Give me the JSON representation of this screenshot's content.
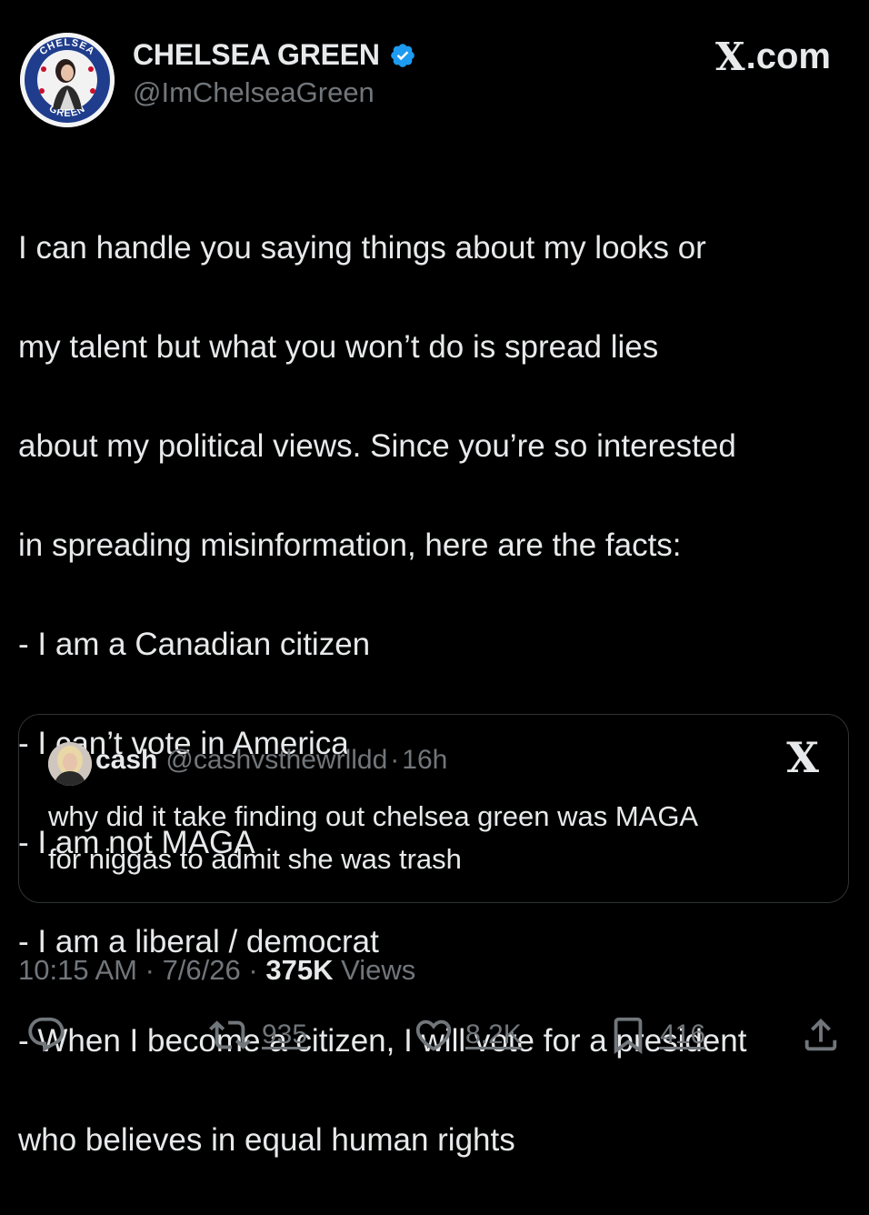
{
  "author": {
    "display_name": "CHELSEA GREEN",
    "handle": "@ImChelseaGreen",
    "avatar_badge_top": "CHELSEA",
    "avatar_badge_bottom": "GREEN",
    "verified": true
  },
  "brand": {
    "logo": "X",
    "text": ".com"
  },
  "tweet": {
    "lines": [
      "I can handle you saying things about my looks or",
      "my talent but what you won’t do is spread lies",
      "about my political views. Since you’re so interested",
      "in spreading misinformation, here are the facts:",
      "- I am a Canadian citizen",
      "- I can’t vote in America",
      "- I am not MAGA",
      "- I am a liberal / democrat",
      "- When I become a citizen, I will vote for a president",
      "who believes in equal human rights"
    ]
  },
  "quote": {
    "name": "cash",
    "handle": "@cashvsthewrlldd",
    "separator": "·",
    "time": "16h",
    "logo": "X",
    "text_lines": [
      "why did it take finding out chelsea green was MAGA",
      "for niggas to admit she was trash"
    ]
  },
  "meta": {
    "time": "10:15 AM",
    "date": "7/6/26",
    "separator": "·",
    "views_count": "375K",
    "views_label": "Views"
  },
  "actions": {
    "reply_icon": "reply-icon",
    "retweet_icon": "retweet-icon",
    "retweets": "935",
    "like_icon": "heart-icon",
    "likes": "8.2K",
    "bookmark_icon": "bookmark-icon",
    "bookmarks": "416",
    "share_icon": "share-icon"
  },
  "colors": {
    "background": "#000000",
    "text": "#e7e9ea",
    "secondary": "#71767b",
    "verified": "#1d9bf0",
    "border": "#2f3336"
  }
}
